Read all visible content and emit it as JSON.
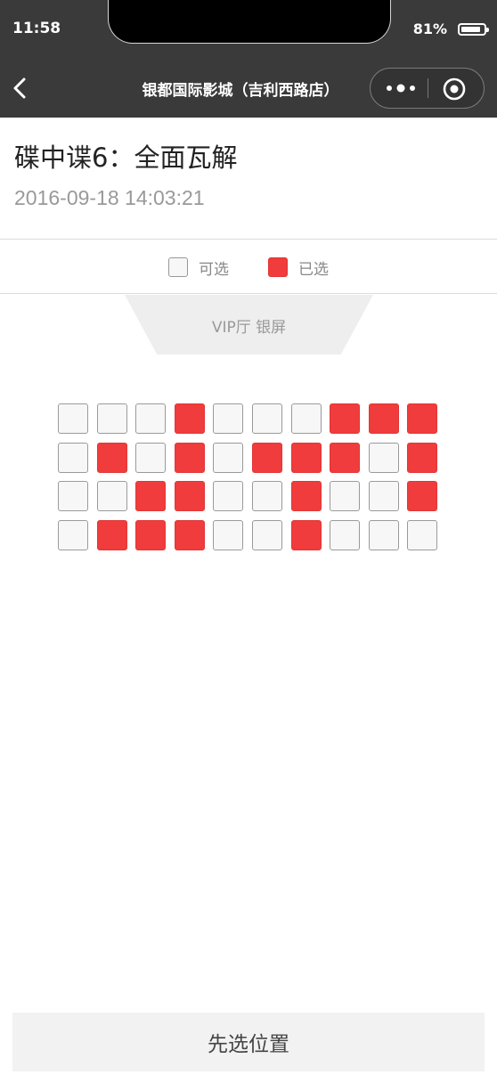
{
  "status_bar": {
    "time": "11:58",
    "battery_percent": "81%",
    "battery_level": 0.81
  },
  "nav": {
    "title": "银都国际影城（吉利西路店）",
    "back_icon": "back-arrow-icon",
    "more_icon": "more-dots-icon",
    "close_icon": "target-close-icon"
  },
  "movie": {
    "title": "碟中谍6：全面瓦解",
    "showtime": "2016-09-18 14:03:21"
  },
  "legend": {
    "available_label": "可选",
    "selected_label": "已选"
  },
  "screen": {
    "label": "VIP厅 银屏"
  },
  "seats": {
    "rows": [
      [
        "available",
        "available",
        "available",
        "selected",
        "available",
        "available",
        "available",
        "selected",
        "selected",
        "selected"
      ],
      [
        "available",
        "selected",
        "available",
        "selected",
        "available",
        "selected",
        "selected",
        "selected",
        "available",
        "selected"
      ],
      [
        "available",
        "available",
        "selected",
        "selected",
        "available",
        "available",
        "selected",
        "available",
        "available",
        "selected"
      ],
      [
        "available",
        "selected",
        "selected",
        "selected",
        "available",
        "available",
        "selected",
        "available",
        "available",
        "available"
      ]
    ]
  },
  "footer": {
    "submit_label": "先选位置"
  },
  "colors": {
    "selected": "#f03c3c",
    "available": "#f7f7f7",
    "navbar": "#3a3a3a"
  }
}
